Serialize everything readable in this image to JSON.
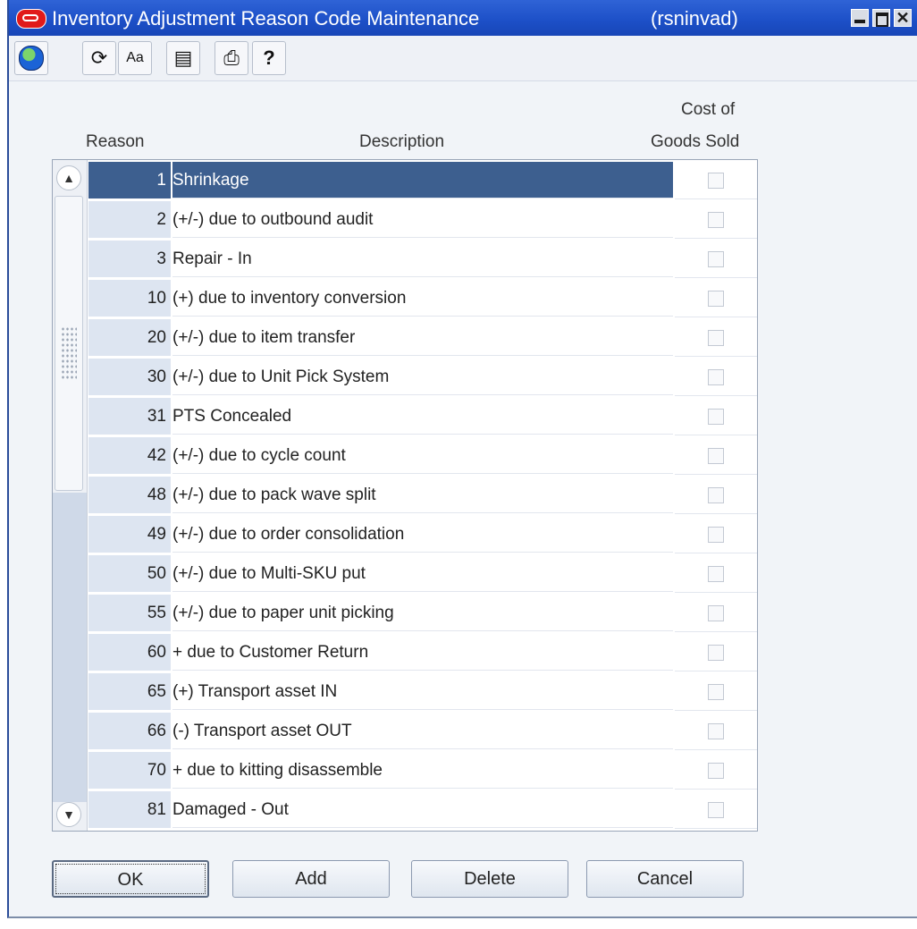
{
  "window": {
    "title": "Inventory Adjustment Reason Code Maintenance",
    "module": "(rsninvad)",
    "close_glyph": "✕"
  },
  "toolbar": {
    "buttons": [
      {
        "name": "globe-icon"
      },
      {
        "name": "undo-icon",
        "glyph": "⟳"
      },
      {
        "name": "font-size-icon",
        "glyph": "Aa"
      },
      {
        "name": "document-icon",
        "glyph": "▤"
      },
      {
        "name": "print-icon",
        "glyph": "⎙"
      },
      {
        "name": "help-icon",
        "glyph": "?"
      }
    ]
  },
  "table": {
    "headers": {
      "reason": "Reason",
      "description": "Description",
      "cogs_line1": "Cost of",
      "cogs_line2": "Goods Sold"
    },
    "rows": [
      {
        "code": "1",
        "description": "Shrinkage",
        "cogs": false,
        "selected": true
      },
      {
        "code": "2",
        "description": "(+/-) due to outbound audit",
        "cogs": false
      },
      {
        "code": "3",
        "description": "Repair - In",
        "cogs": false
      },
      {
        "code": "10",
        "description": "(+) due to inventory conversion",
        "cogs": false
      },
      {
        "code": "20",
        "description": "(+/-) due to item transfer",
        "cogs": false
      },
      {
        "code": "30",
        "description": "(+/-) due to Unit Pick System",
        "cogs": false
      },
      {
        "code": "31",
        "description": "PTS Concealed",
        "cogs": false
      },
      {
        "code": "42",
        "description": "(+/-) due to cycle count",
        "cogs": false
      },
      {
        "code": "48",
        "description": "(+/-) due to pack wave split",
        "cogs": false
      },
      {
        "code": "49",
        "description": "(+/-) due to order consolidation",
        "cogs": false
      },
      {
        "code": "50",
        "description": "(+/-) due to Multi-SKU put",
        "cogs": false
      },
      {
        "code": "55",
        "description": "(+/-) due to paper unit picking",
        "cogs": false
      },
      {
        "code": "60",
        "description": "+ due to Customer Return",
        "cogs": false
      },
      {
        "code": "65",
        "description": "(+) Transport asset IN",
        "cogs": false
      },
      {
        "code": "66",
        "description": "(-) Transport asset OUT",
        "cogs": false
      },
      {
        "code": "70",
        "description": "+ due to kitting disassemble",
        "cogs": false
      },
      {
        "code": "81",
        "description": "Damaged - Out",
        "cogs": false
      }
    ]
  },
  "buttons": {
    "ok": "OK",
    "add": "Add",
    "delete": "Delete",
    "cancel": "Cancel"
  },
  "colors": {
    "titlebar": "#1c4fc7",
    "selected_row": "#3d5f8f",
    "code_cell": "#dde5f1"
  }
}
